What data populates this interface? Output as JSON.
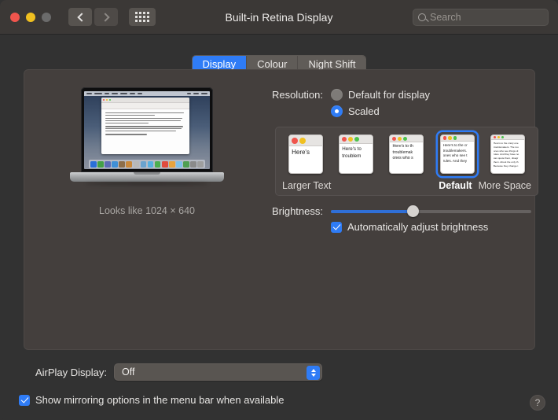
{
  "window": {
    "title": "Built-in Retina Display",
    "traffic": {
      "close": "close-button",
      "minimize": "minimize-button",
      "zoom": "zoom-button"
    },
    "nav": {
      "back": "back-button",
      "forward": "forward-button",
      "grid": "show-all-button"
    },
    "search": {
      "placeholder": "Search"
    }
  },
  "tabs": [
    {
      "label": "Display",
      "active": true
    },
    {
      "label": "Colour",
      "active": false
    },
    {
      "label": "Night Shift",
      "active": false
    }
  ],
  "preview": {
    "caption": "Looks like 1024 × 640",
    "document_text": "Here's to the crazy ones. The misfits. The rebels. The troublemakers. The round pegs in the square holes."
  },
  "resolution": {
    "label": "Resolution:",
    "options": [
      {
        "label": "Default for display",
        "selected": false
      },
      {
        "label": "Scaled",
        "selected": true
      }
    ]
  },
  "scaled": {
    "thumbnails": [
      {
        "index": 1,
        "lines": [
          "Here's"
        ],
        "dots": 2,
        "selected": false
      },
      {
        "index": 2,
        "lines": [
          "Here's to",
          "troublem"
        ],
        "dots": 3,
        "selected": false
      },
      {
        "index": 3,
        "lines": [
          "Here's to th",
          "troublemak",
          "ones who s"
        ],
        "dots": 3,
        "selected": false
      },
      {
        "index": 4,
        "lines": [
          "Here's to the cr",
          "troublemakers.",
          "ones who see t",
          "rules. And they"
        ],
        "dots": 3,
        "selected": true
      },
      {
        "index": 5,
        "lines": [
          "Here's to the crazy one",
          "troublemakers. The rou",
          "ones who see things di",
          "rules. And they have no",
          "can quote them, disagr",
          "them. About the only th",
          "Because they change t"
        ],
        "dots": 3,
        "selected": false
      }
    ],
    "labels": {
      "left": "Larger Text",
      "default": "Default",
      "right": "More Space"
    }
  },
  "brightness": {
    "label": "Brightness:",
    "value_percent": 41,
    "auto_adjust": {
      "label": "Automatically adjust brightness",
      "checked": true
    }
  },
  "airplay": {
    "label": "AirPlay Display:",
    "value": "Off",
    "options": [
      "Off"
    ]
  },
  "mirroring": {
    "label": "Show mirroring options in the menu bar when available",
    "checked": true
  },
  "help": {
    "label": "?"
  },
  "colors": {
    "accent": "#2f7cf6",
    "panel": "#443f3d",
    "window_bg": "#323232",
    "titlebar": "#3b3836"
  }
}
